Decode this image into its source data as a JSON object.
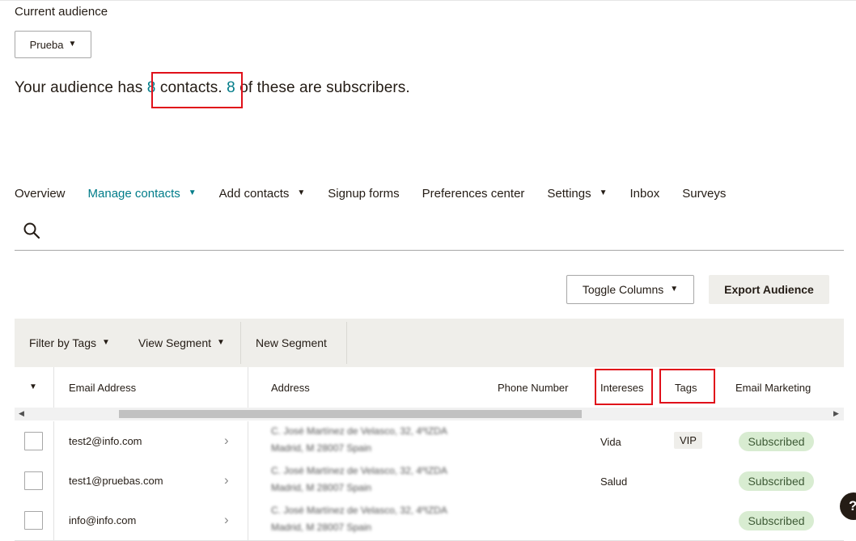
{
  "audience": {
    "current_label": "Current audience",
    "selected": "Prueba",
    "summary": {
      "prefix": "Your audience has ",
      "contacts_count": "8",
      "contacts_label": " contacts. ",
      "subscribers_count": "8",
      "subscribers_label": " of these are subscribers."
    }
  },
  "nav": {
    "items": [
      {
        "label": "Overview",
        "has_menu": false,
        "active": false
      },
      {
        "label": "Manage contacts",
        "has_menu": true,
        "active": true
      },
      {
        "label": "Add contacts",
        "has_menu": true,
        "active": false
      },
      {
        "label": "Signup forms",
        "has_menu": false,
        "active": false
      },
      {
        "label": "Preferences center",
        "has_menu": false,
        "active": false
      },
      {
        "label": "Settings",
        "has_menu": true,
        "active": false
      },
      {
        "label": "Inbox",
        "has_menu": false,
        "active": false
      },
      {
        "label": "Surveys",
        "has_menu": false,
        "active": false
      }
    ]
  },
  "toolbar": {
    "toggle_columns": "Toggle Columns",
    "export_audience": "Export Audience"
  },
  "filters": {
    "filter_by_tags": "Filter by Tags",
    "view_segment": "View Segment",
    "new_segment": "New Segment"
  },
  "table": {
    "columns": [
      "Email Address",
      "Address",
      "Phone Number",
      "Intereses",
      "Tags",
      "Email Marketing"
    ],
    "rows": [
      {
        "email": "test2@info.com",
        "address_line1": "C. José Martínez de Velasco, 32, 4ºIZDA",
        "address_line2": "Madrid, M 28007 Spain",
        "intereses": "Vida",
        "tag": "VIP",
        "status": "Subscribed"
      },
      {
        "email": "test1@pruebas.com",
        "address_line1": "C. José Martínez de Velasco, 32, 4ºIZDA",
        "address_line2": "Madrid, M 28007 Spain",
        "intereses": "Salud",
        "tag": "",
        "status": "Subscribed"
      },
      {
        "email": "info@info.com",
        "address_line1": "C. José Martínez de Velasco, 32, 4ºIZDA",
        "address_line2": "Madrid, M 28007 Spain",
        "intereses": "",
        "tag": "",
        "status": "Subscribed"
      }
    ]
  },
  "help": {
    "label": "?"
  },
  "icons": {
    "search": "search-icon",
    "chevron_down": "chevron-down-icon",
    "chevron_right": "chevron-right-icon",
    "help": "help-icon"
  },
  "colors": {
    "accent": "#007c89",
    "highlight": "#e0101a",
    "status_bg": "#d8ecd1",
    "panel_bg": "#efeeea"
  }
}
